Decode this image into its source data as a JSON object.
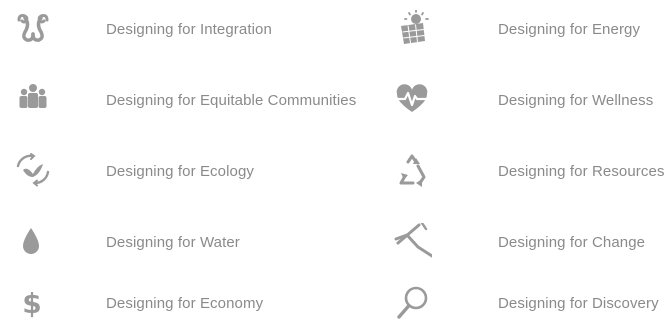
{
  "colors": {
    "icon": "#9a9a9a",
    "text": "#8a8a8a"
  },
  "items": [
    {
      "label": "Designing for Integration",
      "icon": "integration-icon"
    },
    {
      "label": "Designing for Equitable Communities",
      "icon": "community-icon"
    },
    {
      "label": "Designing for Ecology",
      "icon": "ecology-icon"
    },
    {
      "label": "Designing for Water",
      "icon": "water-drop-icon"
    },
    {
      "label": "Designing for Economy",
      "icon": "dollar-icon"
    },
    {
      "label": "Designing for Energy",
      "icon": "solar-panel-icon"
    },
    {
      "label": "Designing for Wellness",
      "icon": "heartbeat-icon"
    },
    {
      "label": "Designing for Resources",
      "icon": "recycle-icon"
    },
    {
      "label": "Designing for Change",
      "icon": "change-graph-icon"
    },
    {
      "label": "Designing for Discovery",
      "icon": "magnifier-icon"
    }
  ]
}
